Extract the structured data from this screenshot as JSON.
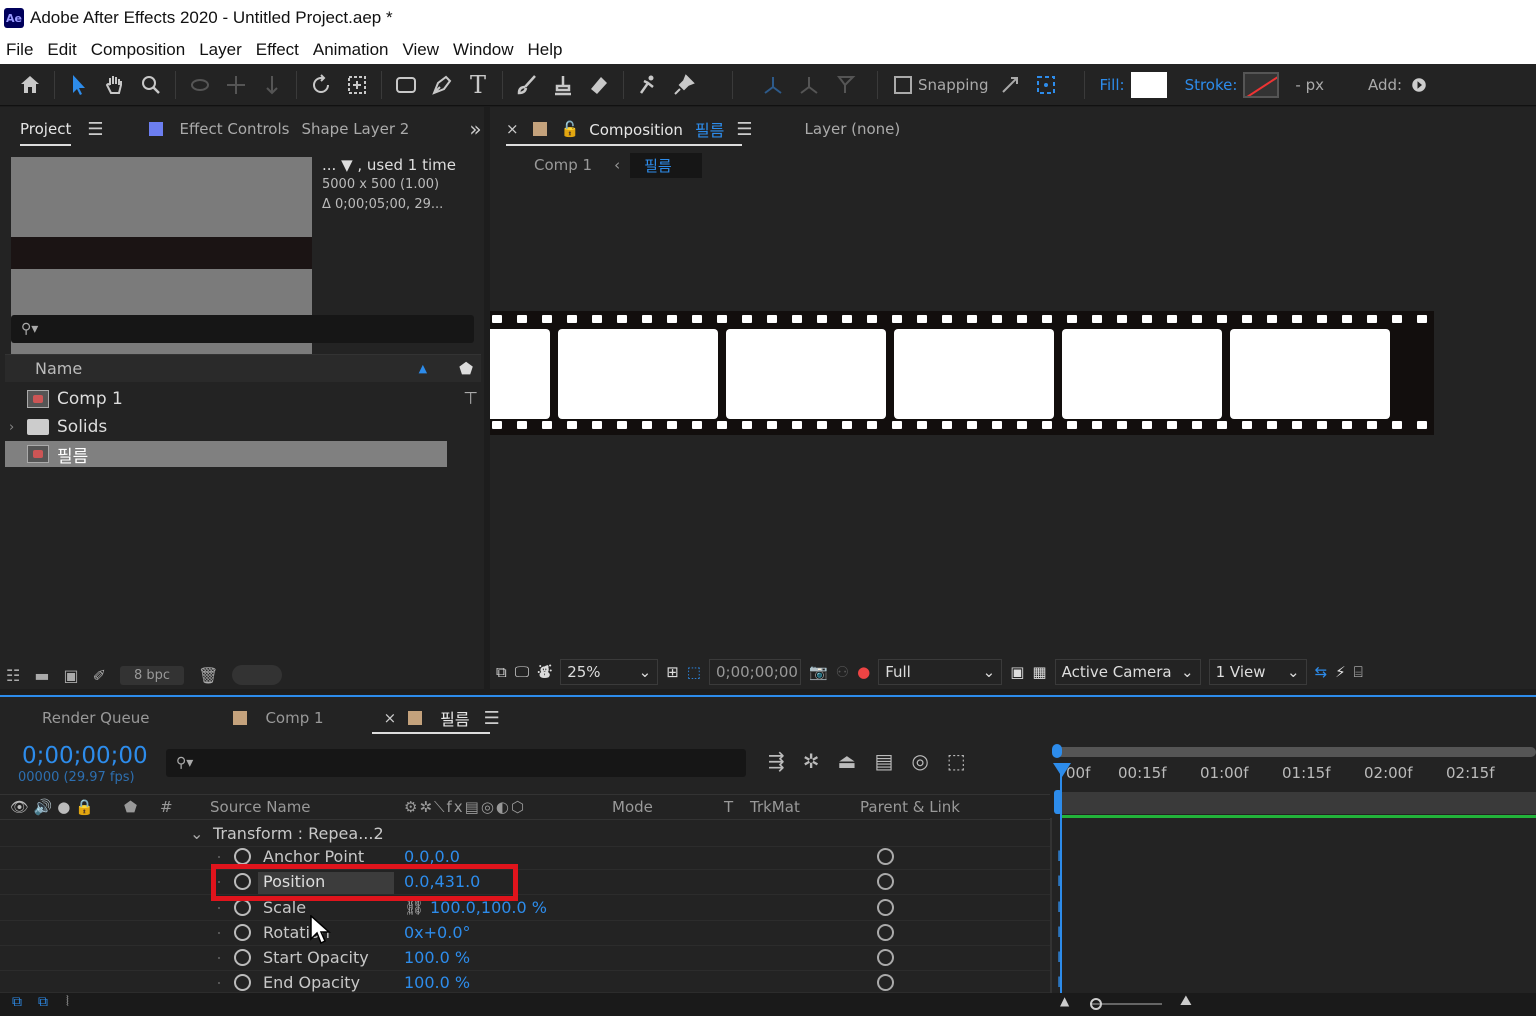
{
  "window": {
    "app_icon": "Ae",
    "title": "Adobe After Effects 2020 - Untitled Project.aep *"
  },
  "menu": [
    "File",
    "Edit",
    "Composition",
    "Layer",
    "Effect",
    "Animation",
    "View",
    "Window",
    "Help"
  ],
  "toolbar": {
    "snapping_label": "Snapping",
    "fill_label": "Fill:",
    "stroke_label": "Stroke:",
    "px_label": "- px",
    "add_label": "Add:",
    "fill_color": "#ffffff"
  },
  "project_panel": {
    "tab_project": "Project",
    "tab_effect_controls": "Effect Controls",
    "effect_controls_target": "Shape Layer 2",
    "info_line1": "... ▼ , used 1 time",
    "info_line2": "5000 x 500 (1.00)",
    "info_line3": "Δ 0;00;05;00, 29...",
    "column_name": "Name",
    "items": [
      {
        "name": "Comp 1",
        "type": "composition"
      },
      {
        "name": "Solids",
        "type": "folder"
      },
      {
        "name": "필름",
        "type": "composition",
        "selected": true
      }
    ],
    "bpc": "8 bpc"
  },
  "composition_panel": {
    "tab_label": "Composition",
    "comp_name": "필름",
    "layer_tab": "Layer (none)",
    "breadcrumb_parent": "Comp 1",
    "breadcrumb_current": "필름",
    "zoom": "25%",
    "timecode": "0;00;00;00",
    "resolution": "Full",
    "camera": "Active Camera",
    "view": "1 View"
  },
  "timeline_panel": {
    "tab_render_queue": "Render Queue",
    "tab_comp1": "Comp 1",
    "tab_active": "필름",
    "timecode": "0;00;00;00",
    "fps": "00000 (29.97 fps)",
    "columns": {
      "hash": "#",
      "source_name": "Source Name",
      "mode": "Mode",
      "t": "T",
      "trkmat": "TrkMat",
      "parent": "Parent & Link"
    },
    "group_label": "Transform : Repea...2",
    "properties": [
      {
        "name": "Anchor Point",
        "value": "0.0,0.0"
      },
      {
        "name": "Position",
        "value": "0.0,431.0",
        "highlighted": true
      },
      {
        "name": "Scale",
        "value": "100.0,100.0 %"
      },
      {
        "name": "Rotation",
        "value": "0x+0.0°"
      },
      {
        "name": "Start Opacity",
        "value": "100.0 %"
      },
      {
        "name": "End Opacity",
        "value": "100.0 %"
      }
    ],
    "ruler_labels": [
      "00f",
      "00:15f",
      "01:00f",
      "01:15f",
      "02:00f",
      "02:15f"
    ]
  },
  "accent_color": "#2d8ceb",
  "highlight_color": "#e0141c"
}
